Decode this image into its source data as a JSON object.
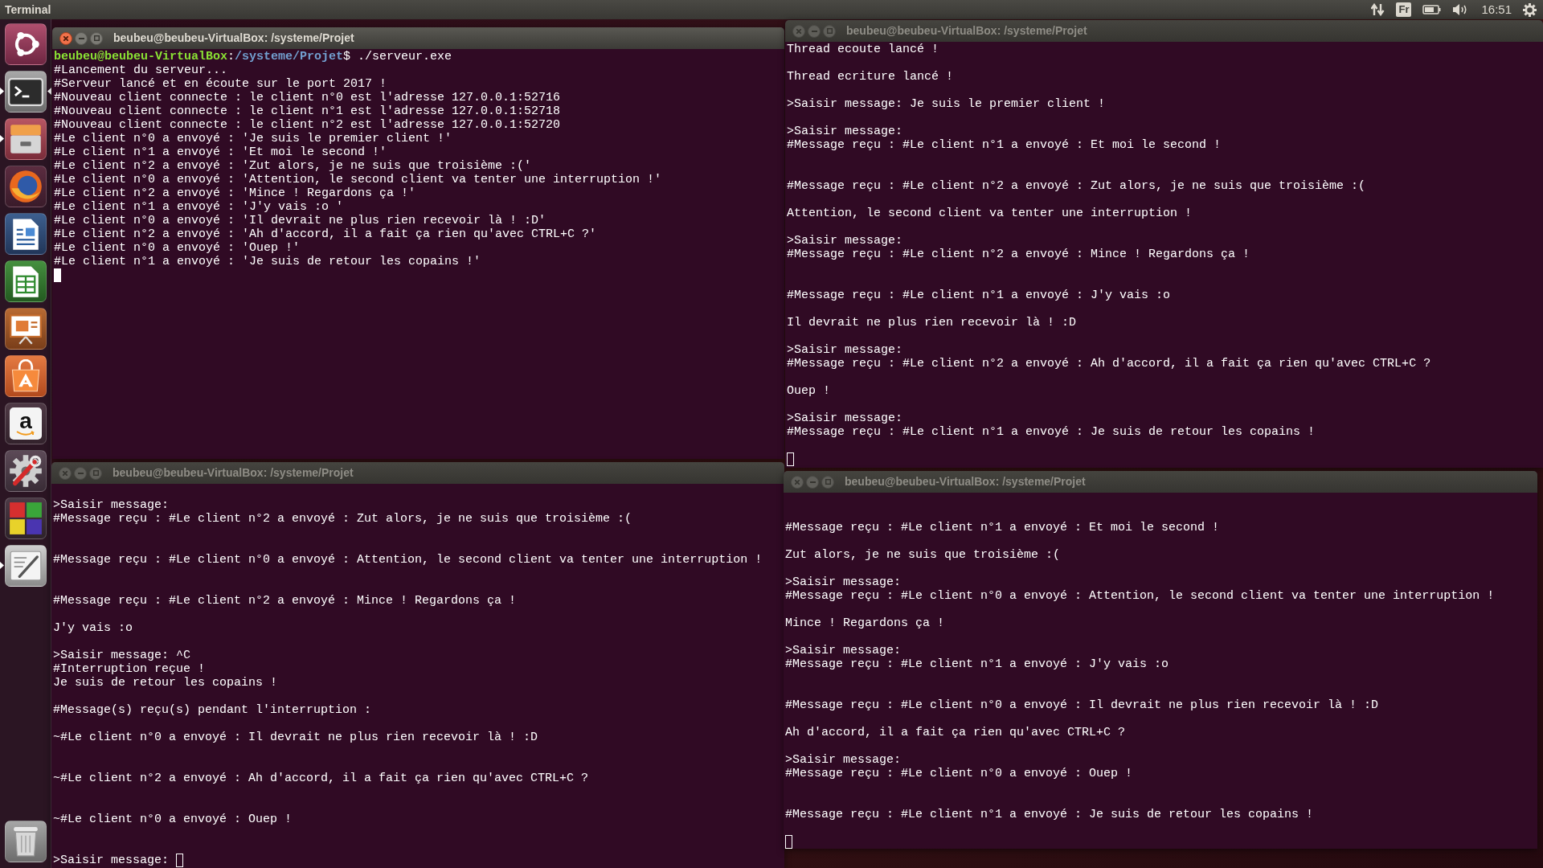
{
  "top_panel": {
    "app_name": "Terminal",
    "keyboard_layout": "Fr",
    "clock": "16:51"
  },
  "launcher": {
    "items": [
      {
        "kind": "dash",
        "running": false,
        "focused": false
      },
      {
        "kind": "terminal",
        "running": true,
        "focused": true
      },
      {
        "kind": "files",
        "running": true,
        "focused": false
      },
      {
        "kind": "browser",
        "running": false,
        "focused": false
      },
      {
        "kind": "writer",
        "running": false,
        "focused": false
      },
      {
        "kind": "calc",
        "running": false,
        "focused": false
      },
      {
        "kind": "impress",
        "running": false,
        "focused": false
      },
      {
        "kind": "software",
        "running": false,
        "focused": false
      },
      {
        "kind": "amazon",
        "letter": "a",
        "running": false,
        "focused": false
      },
      {
        "kind": "settings",
        "running": false,
        "focused": false
      },
      {
        "kind": "squares",
        "running": false,
        "focused": false
      },
      {
        "kind": "text_editor",
        "running": true,
        "focused": false
      }
    ]
  },
  "windows": [
    {
      "title": "beubeu@beubeu-VirtualBox: /systeme/Projet",
      "active": true,
      "lines": [
        {
          "kind": "prompt",
          "user": "beubeu@beubeu-VirtualBox",
          "separator": ":",
          "path": "/systeme/Projet",
          "command": "$ ./serveur.exe"
        },
        {
          "kind": "text",
          "text": "#Lancement du serveur..."
        },
        {
          "kind": "text",
          "text": "#Serveur lancé et en écoute sur le port 2017 !"
        },
        {
          "kind": "text",
          "text": "#Nouveau client connecte : le client n°0 est l'adresse 127.0.0.1:52716"
        },
        {
          "kind": "text",
          "text": "#Nouveau client connecte : le client n°1 est l'adresse 127.0.0.1:52718"
        },
        {
          "kind": "text",
          "text": "#Nouveau client connecte : le client n°2 est l'adresse 127.0.0.1:52720"
        },
        {
          "kind": "text",
          "text": "#Le client n°0 a envoyé : 'Je suis le premier client !'"
        },
        {
          "kind": "text",
          "text": "#Le client n°1 a envoyé : 'Et moi le second !'"
        },
        {
          "kind": "text",
          "text": "#Le client n°2 a envoyé : 'Zut alors, je ne suis que troisième :('"
        },
        {
          "kind": "text",
          "text": "#Le client n°0 a envoyé : 'Attention, le second client va tenter une interruption !'"
        },
        {
          "kind": "text",
          "text": "#Le client n°2 a envoyé : 'Mince ! Regardons ça !'"
        },
        {
          "kind": "text",
          "text": "#Le client n°1 a envoyé : 'J'y vais :o '"
        },
        {
          "kind": "text",
          "text": "#Le client n°0 a envoyé : 'Il devrait ne plus rien recevoir là ! :D'"
        },
        {
          "kind": "text",
          "text": "#Le client n°2 a envoyé : 'Ah d'accord, il a fait ça rien qu'avec CTRL+C ?'"
        },
        {
          "kind": "text",
          "text": "#Le client n°0 a envoyé : 'Ouep !'"
        },
        {
          "kind": "text",
          "text": "#Le client n°1 a envoyé : 'Je suis de retour les copains !'"
        },
        {
          "kind": "cursor"
        }
      ]
    },
    {
      "title": "beubeu@beubeu-VirtualBox: /systeme/Projet",
      "active": false,
      "lines": [
        {
          "kind": "text",
          "text": "Thread ecoute lancé !"
        },
        {
          "kind": "blank"
        },
        {
          "kind": "text",
          "text": "Thread ecriture lancé !"
        },
        {
          "kind": "blank"
        },
        {
          "kind": "text",
          "text": ">Saisir message: Je suis le premier client !"
        },
        {
          "kind": "blank"
        },
        {
          "kind": "text",
          "text": ">Saisir message:"
        },
        {
          "kind": "text",
          "text": "#Message reçu : #Le client n°1 a envoyé : Et moi le second !"
        },
        {
          "kind": "blank"
        },
        {
          "kind": "blank"
        },
        {
          "kind": "text",
          "text": "#Message reçu : #Le client n°2 a envoyé : Zut alors, je ne suis que troisième :("
        },
        {
          "kind": "blank"
        },
        {
          "kind": "text",
          "text": "Attention, le second client va tenter une interruption !"
        },
        {
          "kind": "blank"
        },
        {
          "kind": "text",
          "text": ">Saisir message:"
        },
        {
          "kind": "text",
          "text": "#Message reçu : #Le client n°2 a envoyé : Mince ! Regardons ça !"
        },
        {
          "kind": "blank"
        },
        {
          "kind": "blank"
        },
        {
          "kind": "text",
          "text": "#Message reçu : #Le client n°1 a envoyé : J'y vais :o"
        },
        {
          "kind": "blank"
        },
        {
          "kind": "text",
          "text": "Il devrait ne plus rien recevoir là ! :D"
        },
        {
          "kind": "blank"
        },
        {
          "kind": "text",
          "text": ">Saisir message:"
        },
        {
          "kind": "text",
          "text": "#Message reçu : #Le client n°2 a envoyé : Ah d'accord, il a fait ça rien qu'avec CTRL+C ?"
        },
        {
          "kind": "blank"
        },
        {
          "kind": "text",
          "text": "Ouep !"
        },
        {
          "kind": "blank"
        },
        {
          "kind": "text",
          "text": ">Saisir message:"
        },
        {
          "kind": "text",
          "text": "#Message reçu : #Le client n°1 a envoyé : Je suis de retour les copains !"
        },
        {
          "kind": "blank"
        },
        {
          "kind": "cursor"
        }
      ]
    },
    {
      "title": "beubeu@beubeu-VirtualBox: /systeme/Projet",
      "active": false,
      "lines": [
        {
          "kind": "blank"
        },
        {
          "kind": "text",
          "text": ">Saisir message:"
        },
        {
          "kind": "text",
          "text": "#Message reçu : #Le client n°2 a envoyé : Zut alors, je ne suis que troisième :("
        },
        {
          "kind": "blank"
        },
        {
          "kind": "blank"
        },
        {
          "kind": "text",
          "text": "#Message reçu : #Le client n°0 a envoyé : Attention, le second client va tenter une interruption !"
        },
        {
          "kind": "blank"
        },
        {
          "kind": "blank"
        },
        {
          "kind": "text",
          "text": "#Message reçu : #Le client n°2 a envoyé : Mince ! Regardons ça !"
        },
        {
          "kind": "blank"
        },
        {
          "kind": "text",
          "text": "J'y vais :o"
        },
        {
          "kind": "blank"
        },
        {
          "kind": "text",
          "text": ">Saisir message: ^C"
        },
        {
          "kind": "text",
          "text": "#Interruption reçue !"
        },
        {
          "kind": "text",
          "text": "Je suis de retour les copains !"
        },
        {
          "kind": "blank"
        },
        {
          "kind": "text",
          "text": "#Message(s) reçu(s) pendant l'interruption :"
        },
        {
          "kind": "blank"
        },
        {
          "kind": "text",
          "text": "~#Le client n°0 a envoyé : Il devrait ne plus rien recevoir là ! :D"
        },
        {
          "kind": "blank"
        },
        {
          "kind": "blank"
        },
        {
          "kind": "text",
          "text": "~#Le client n°2 a envoyé : Ah d'accord, il a fait ça rien qu'avec CTRL+C ?"
        },
        {
          "kind": "blank"
        },
        {
          "kind": "blank"
        },
        {
          "kind": "text",
          "text": "~#Le client n°0 a envoyé : Ouep !"
        },
        {
          "kind": "blank"
        },
        {
          "kind": "blank"
        },
        {
          "kind": "cursor",
          "text": ">Saisir message: "
        }
      ]
    },
    {
      "title": "beubeu@beubeu-VirtualBox: /systeme/Projet",
      "active": false,
      "lines": [
        {
          "kind": "blank"
        },
        {
          "kind": "blank"
        },
        {
          "kind": "text",
          "text": "#Message reçu : #Le client n°1 a envoyé : Et moi le second !"
        },
        {
          "kind": "blank"
        },
        {
          "kind": "text",
          "text": "Zut alors, je ne suis que troisième :("
        },
        {
          "kind": "blank"
        },
        {
          "kind": "text",
          "text": ">Saisir message:"
        },
        {
          "kind": "text",
          "text": "#Message reçu : #Le client n°0 a envoyé : Attention, le second client va tenter une interruption !"
        },
        {
          "kind": "blank"
        },
        {
          "kind": "text",
          "text": "Mince ! Regardons ça !"
        },
        {
          "kind": "blank"
        },
        {
          "kind": "text",
          "text": ">Saisir message:"
        },
        {
          "kind": "text",
          "text": "#Message reçu : #Le client n°1 a envoyé : J'y vais :o"
        },
        {
          "kind": "blank"
        },
        {
          "kind": "blank"
        },
        {
          "kind": "text",
          "text": "#Message reçu : #Le client n°0 a envoyé : Il devrait ne plus rien recevoir là ! :D"
        },
        {
          "kind": "blank"
        },
        {
          "kind": "text",
          "text": "Ah d'accord, il a fait ça rien qu'avec CTRL+C ?"
        },
        {
          "kind": "blank"
        },
        {
          "kind": "text",
          "text": ">Saisir message:"
        },
        {
          "kind": "text",
          "text": "#Message reçu : #Le client n°0 a envoyé : Ouep !"
        },
        {
          "kind": "blank"
        },
        {
          "kind": "blank"
        },
        {
          "kind": "text",
          "text": "#Message reçu : #Le client n°1 a envoyé : Je suis de retour les copains !"
        },
        {
          "kind": "blank"
        },
        {
          "kind": "cursor"
        }
      ]
    }
  ]
}
